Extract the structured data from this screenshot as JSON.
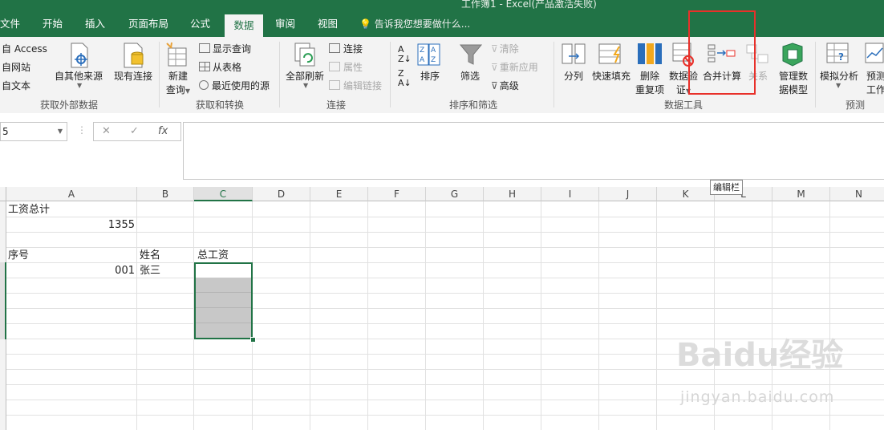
{
  "window": {
    "title": "工作簿1 - Excel(产品激活失败)"
  },
  "tabs": [
    "文件",
    "开始",
    "插入",
    "页面布局",
    "公式",
    "数据",
    "审阅",
    "视图"
  ],
  "active_tab": "数据",
  "tell_me": "告诉我您想要做什么...",
  "ribbon": {
    "get_external": {
      "access": "自 Access",
      "web": "自网站",
      "text": "自文本",
      "other": "自其他来源",
      "existing": "现有连接",
      "label": "获取外部数据"
    },
    "transform": {
      "new_query": "新建",
      "new_query2": "查询",
      "show_queries": "显示查询",
      "from_table": "从表格",
      "recent": "最近使用的源",
      "label": "获取和转换"
    },
    "connections": {
      "refresh_all": "全部刷新",
      "conn": "连接",
      "props": "属性",
      "edit_links": "编辑链接",
      "label": "连接"
    },
    "sort_filter": {
      "sort": "排序",
      "filter": "筛选",
      "clear": "清除",
      "reapply": "重新应用",
      "advanced": "高级",
      "label": "排序和筛选"
    },
    "data_tools": {
      "split": "分列",
      "flash_fill": "快速填充",
      "remove_dup": "删除",
      "remove_dup2": "重复项",
      "validate": "数据验",
      "validate2": "证",
      "consolidate": "合并计算",
      "relations": "关系",
      "manage_model": "管理数",
      "manage_model2": "据模型",
      "label": "数据工具"
    },
    "forecast": {
      "whatif": "模拟分析",
      "sheet": "预测",
      "sheet2": "工作表",
      "label": "预测"
    }
  },
  "formula_bar": {
    "name_box": "5",
    "cancel": "✕",
    "enter": "✓",
    "fx": "fx",
    "value": ""
  },
  "tooltip": "编辑栏",
  "columns": [
    "A",
    "B",
    "C",
    "D",
    "E",
    "F",
    "G",
    "H",
    "I",
    "J",
    "K",
    "L",
    "M",
    "N"
  ],
  "selected_column": "C",
  "cells": {
    "a1": "工资总计",
    "a2": "1355",
    "a4": "序号",
    "b4": "姓名",
    "c4": "总工资",
    "a5": "001",
    "b5": "张三"
  },
  "watermark": {
    "brand": "Baidu经验",
    "url": "jingyan.baidu.com"
  },
  "colors": {
    "excel_green": "#217346",
    "highlight_red": "#e8302a"
  }
}
